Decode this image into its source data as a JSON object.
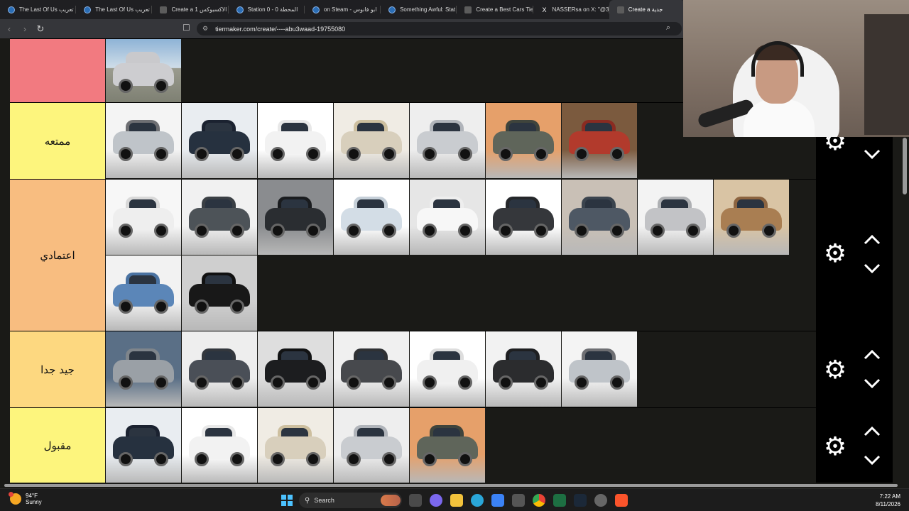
{
  "browser": {
    "tabs": [
      {
        "title": "The Last Of Us تعريب",
        "icon": "steam-icon"
      },
      {
        "title": "The Last Of Us تعريب",
        "icon": "steam-icon"
      },
      {
        "title": "Create a 1 الاكسبوكس",
        "icon": "tiermaker-icon"
      },
      {
        "title": "Station 0 - 0 المحطة",
        "icon": "steam-icon"
      },
      {
        "title": "on Steam - ابو فانوس",
        "icon": "steam-icon"
      },
      {
        "title": "Something Awful: Stat",
        "icon": "steam-icon"
      },
      {
        "title": "Create a Best Cars Tie",
        "icon": "tiermaker-icon"
      },
      {
        "title": "NASSERsa on X: \"@3",
        "icon": "x-icon"
      },
      {
        "title": "Create a جدية",
        "icon": "tiermaker-icon",
        "active": true
      }
    ],
    "url": "tiermaker.com/create/----abu3waad-19755080"
  },
  "tiers": [
    {
      "id": "tier-top",
      "label": "",
      "color": "#f27a80",
      "cars": 1
    },
    {
      "id": "tier-fun",
      "label": "ممتعه",
      "color": "#fdf57d",
      "cars": 7
    },
    {
      "id": "tier-reliable",
      "label": "اعتمادي",
      "color": "#f8bd80",
      "cars": 11
    },
    {
      "id": "tier-very-good",
      "label": "جيد جدا",
      "color": "#fdd880",
      "cars": 7
    },
    {
      "id": "tier-acceptable",
      "label": "مقبول",
      "color": "#fdf57d",
      "cars": 5
    }
  ],
  "icons": {
    "settings": "gear-icon",
    "up": "chevron-up-icon",
    "down": "chevron-down-icon"
  },
  "taskbar": {
    "weather_temp": "94°F",
    "weather_desc": "Sunny",
    "search_label": "Search",
    "time": "7:22 AM",
    "date": "8/11/2026"
  }
}
